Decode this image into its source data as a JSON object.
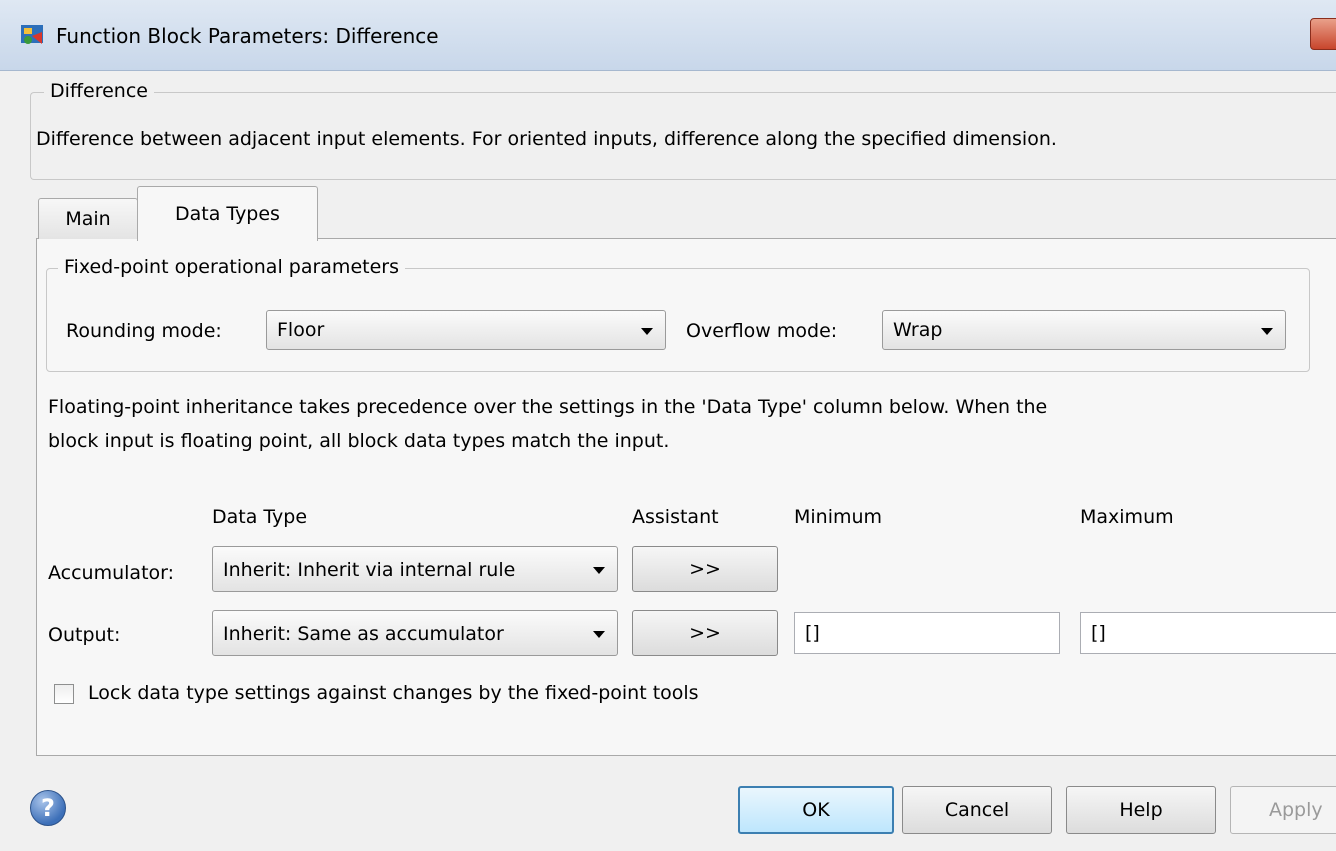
{
  "window": {
    "title": "Function Block Parameters: Difference"
  },
  "block": {
    "group_label": "Difference",
    "description": "Difference between adjacent input elements.  For oriented inputs, difference along the specified dimension."
  },
  "tabs": [
    {
      "label": "Main",
      "active": false
    },
    {
      "label": "Data Types",
      "active": true
    }
  ],
  "fixed_point": {
    "group_label": "Fixed-point operational parameters",
    "rounding_label": "Rounding mode:",
    "rounding_value": "Floor",
    "overflow_label": "Overflow mode:",
    "overflow_value": "Wrap"
  },
  "inheritance_note": {
    "line1": "Floating-point inheritance takes precedence over the settings in the 'Data Type' column below. When the",
    "line2": "block input is floating point, all block data types match the input."
  },
  "table": {
    "headers": {
      "data_type": "Data Type",
      "assistant": "Assistant",
      "minimum": "Minimum",
      "maximum": "Maximum"
    },
    "rows": [
      {
        "label": "Accumulator:",
        "data_type": "Inherit: Inherit via internal rule",
        "assistant": ">>"
      },
      {
        "label": "Output:",
        "data_type": "Inherit: Same as accumulator",
        "assistant": ">>",
        "minimum": "[]",
        "maximum": "[]"
      }
    ]
  },
  "lock": {
    "label": "Lock data type settings against changes by the fixed-point tools",
    "checked": false
  },
  "buttons": {
    "ok": "OK",
    "cancel": "Cancel",
    "help": "Help",
    "apply": "Apply"
  },
  "icons": {
    "app": "simulink-block-icon",
    "help": "question-mark-icon",
    "dropdown": "chevron-down-icon"
  }
}
